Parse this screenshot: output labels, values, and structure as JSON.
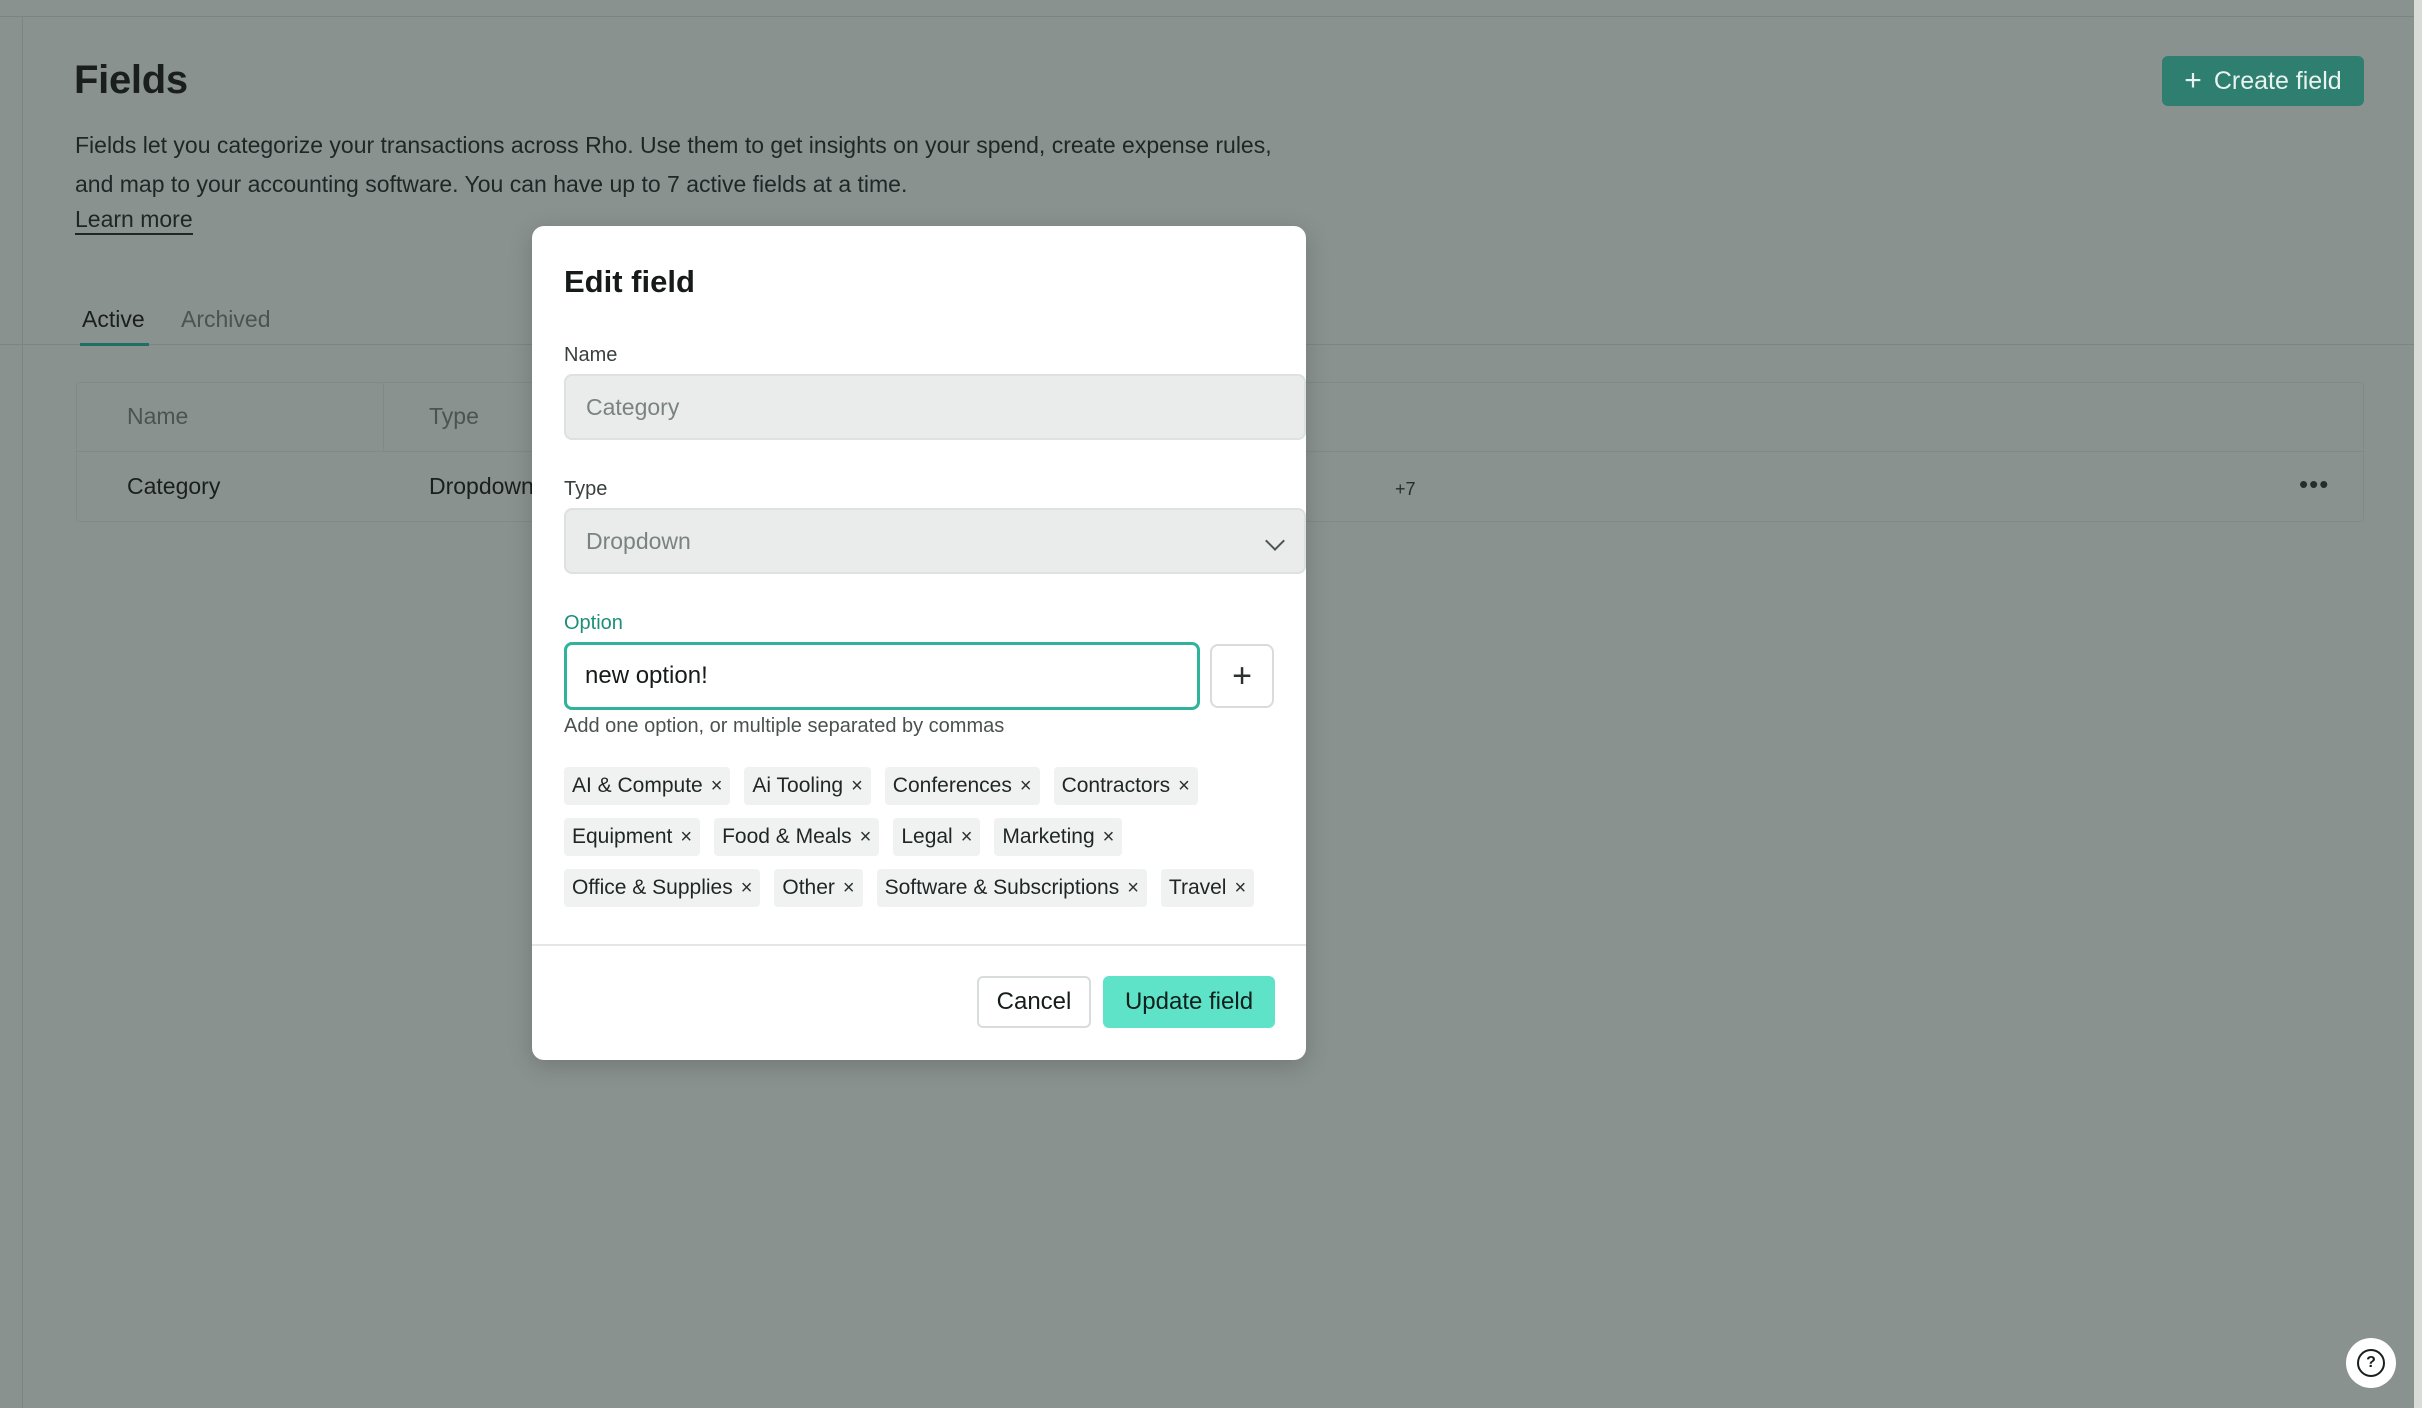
{
  "page": {
    "title": "Fields",
    "create_button_label": "Create field",
    "description": "Fields let you categorize your transactions across Rho. Use them to get insights on your spend, create expense rules, and map to your accounting software. You can have up to 7 active fields at a time.",
    "learn_more": "Learn more",
    "tabs": [
      {
        "label": "Active",
        "active": true
      },
      {
        "label": "Archived",
        "active": false
      }
    ],
    "table": {
      "columns": [
        "Name",
        "Type"
      ],
      "rows": [
        {
          "name": "Category",
          "type": "Dropdown",
          "more_options": "+7",
          "menu_icon": "ellipsis-icon"
        }
      ]
    },
    "help_icon": "question-circle-icon"
  },
  "modal": {
    "title": "Edit field",
    "name_label": "Name",
    "name_value": "Category",
    "type_label": "Type",
    "type_value": "Dropdown",
    "option_label": "Option",
    "option_value": "new option!",
    "option_hint": "Add one option, or multiple separated by commas",
    "options": [
      "AI & Compute",
      "Ai Tooling",
      "Conferences",
      "Contractors",
      "Equipment",
      "Food & Meals",
      "Legal",
      "Marketing",
      "Office & Supplies",
      "Other",
      "Software & Subscriptions",
      "Travel"
    ],
    "remove_glyph": "×",
    "cancel_label": "Cancel",
    "update_label": "Update field"
  },
  "colors": {
    "overlay": "#8a9290",
    "accent": "#2fb39b",
    "primary_button": "#5fe3c8",
    "create_button": "#2f7f71"
  }
}
